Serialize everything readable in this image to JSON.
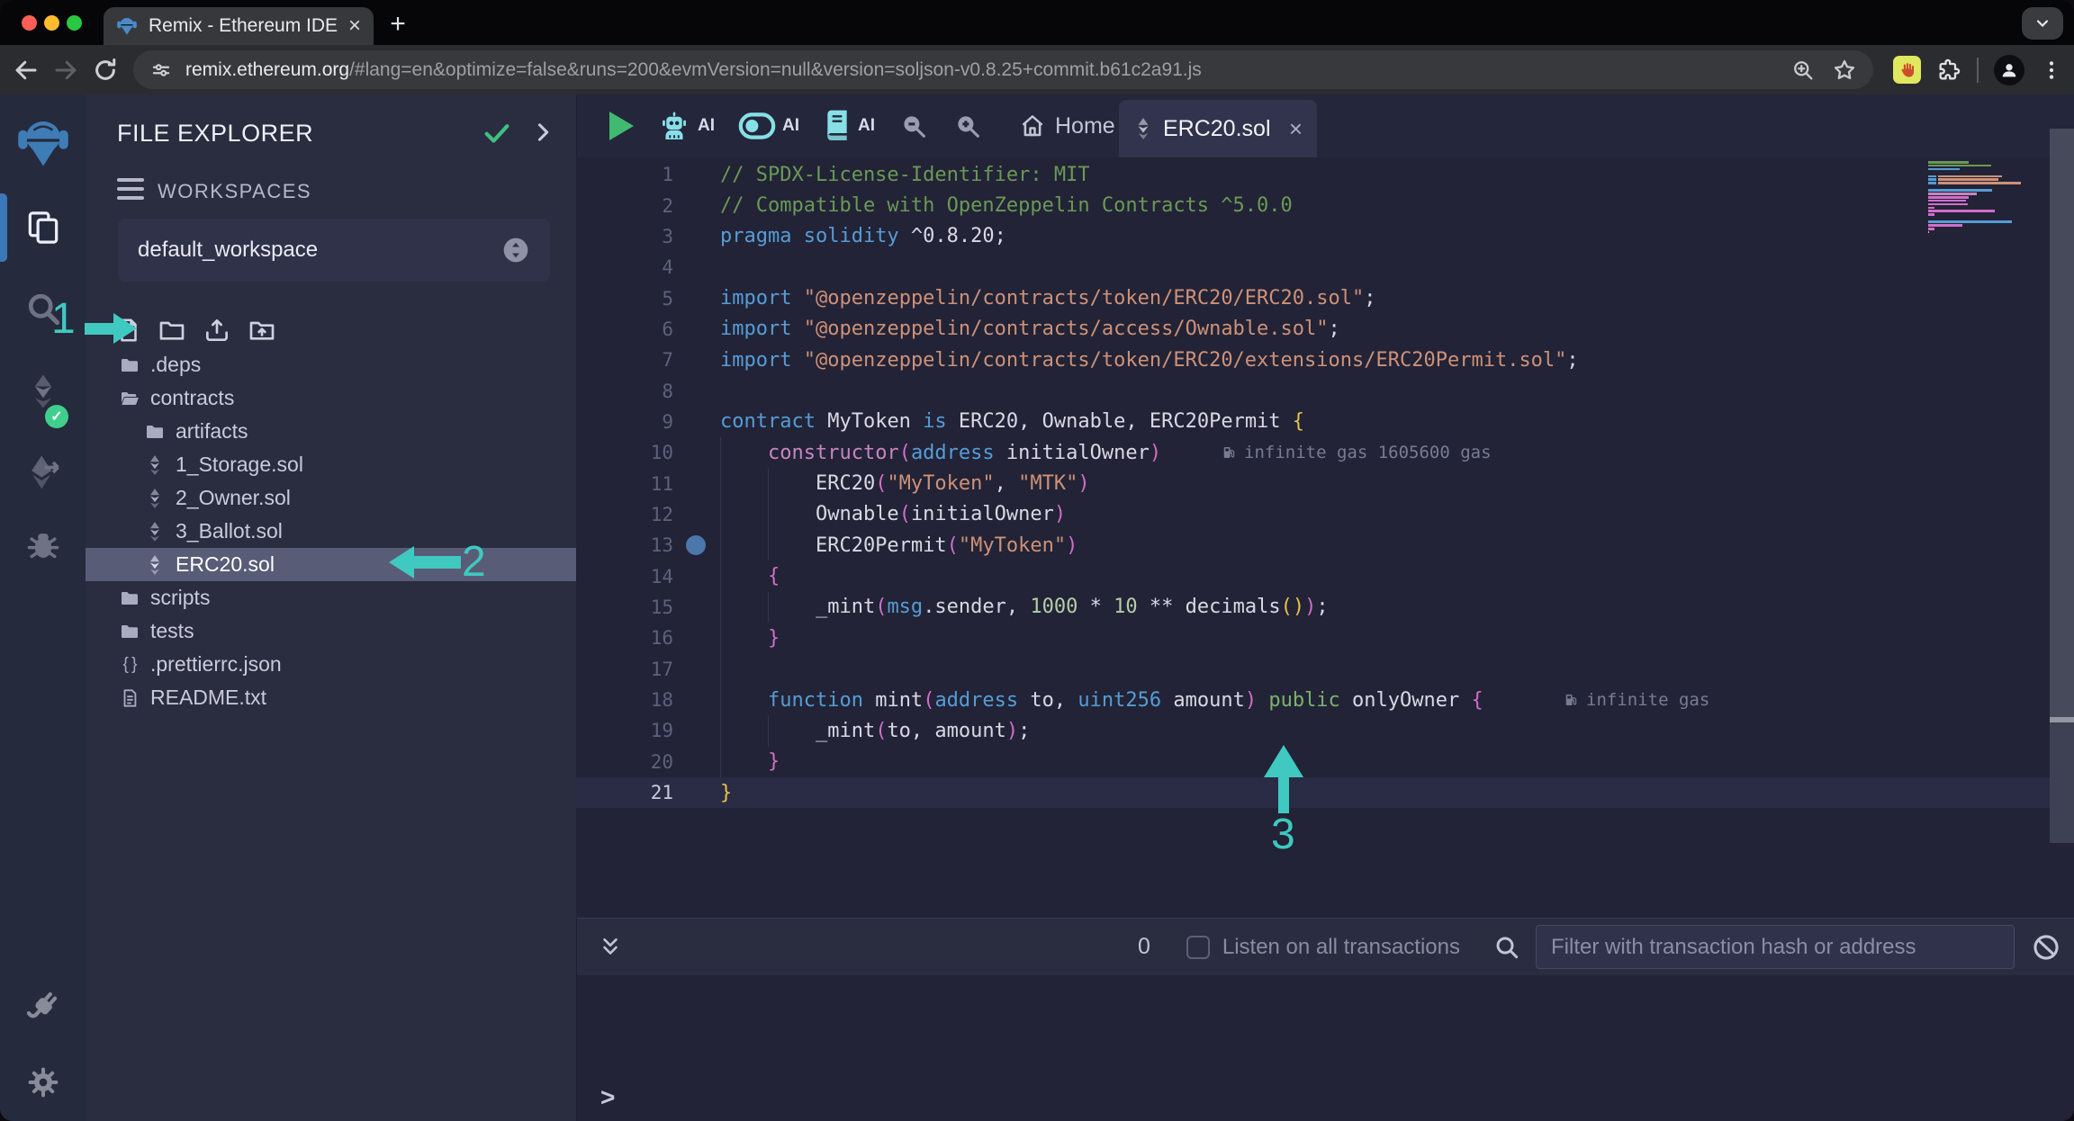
{
  "browser": {
    "tab_title": "Remix - Ethereum IDE",
    "new_tab": "+",
    "close_tab": "×",
    "url": {
      "domain": "remix.ethereum.org",
      "path": "/#lang=en&optimize=false&runs=200&evmVersion=null&version=soljson-v0.8.25+commit.b61c2a91.js"
    }
  },
  "activity_bar": {
    "icons": [
      "remix-logo",
      "file-explorer-icon",
      "search-icon",
      "solidity-compiler-icon",
      "deploy-run-icon",
      "debugger-icon",
      "plugin-manager-icon",
      "settings-icon"
    ],
    "compiler_badge": "check"
  },
  "file_explorer": {
    "title": "FILE EXPLORER",
    "workspaces_label": "WORKSPACES",
    "workspace_name": "default_workspace",
    "action_icons": [
      "new-file-icon",
      "new-folder-icon",
      "upload-file-icon",
      "upload-folder-icon"
    ],
    "tree": [
      {
        "label": ".deps",
        "icon": "folder",
        "indent": 0,
        "selected": false
      },
      {
        "label": "contracts",
        "icon": "folder-open",
        "indent": 0,
        "selected": false
      },
      {
        "label": "artifacts",
        "icon": "folder",
        "indent": 1,
        "selected": false
      },
      {
        "label": "1_Storage.sol",
        "icon": "solidity",
        "indent": 1,
        "selected": false
      },
      {
        "label": "2_Owner.sol",
        "icon": "solidity",
        "indent": 1,
        "selected": false
      },
      {
        "label": "3_Ballot.sol",
        "icon": "solidity",
        "indent": 1,
        "selected": false
      },
      {
        "label": "ERC20.sol",
        "icon": "solidity",
        "indent": 1,
        "selected": true
      },
      {
        "label": "scripts",
        "icon": "folder",
        "indent": 0,
        "selected": false
      },
      {
        "label": "tests",
        "icon": "folder",
        "indent": 0,
        "selected": false
      },
      {
        "label": ".prettierrc.json",
        "icon": "braces",
        "indent": 0,
        "selected": false
      },
      {
        "label": "README.txt",
        "icon": "file",
        "indent": 0,
        "selected": false
      }
    ]
  },
  "editor": {
    "ai_label": "AI",
    "home_label": "Home",
    "file_tab": "ERC20.sol",
    "close_tab": "×",
    "active_line": 21,
    "breakpoint_line": 13,
    "lines": [
      {
        "num": 1,
        "tokens": [
          [
            "c",
            "// SPDX-License-Identifier: MIT"
          ]
        ]
      },
      {
        "num": 2,
        "tokens": [
          [
            "c",
            "// Compatible with OpenZeppelin Contracts ^5.0.0"
          ]
        ]
      },
      {
        "num": 3,
        "tokens": [
          [
            "k",
            "pragma solidity"
          ],
          [
            "w",
            " ^0.8.20;"
          ]
        ]
      },
      {
        "num": 4,
        "tokens": []
      },
      {
        "num": 5,
        "tokens": [
          [
            "k",
            "import"
          ],
          [
            "w",
            " "
          ],
          [
            "s",
            "\"@openzeppelin/contracts/token/ERC20/ERC20.sol\""
          ],
          [
            "w",
            ";"
          ]
        ]
      },
      {
        "num": 6,
        "tokens": [
          [
            "k",
            "import"
          ],
          [
            "w",
            " "
          ],
          [
            "s",
            "\"@openzeppelin/contracts/access/Ownable.sol\""
          ],
          [
            "w",
            ";"
          ]
        ]
      },
      {
        "num": 7,
        "tokens": [
          [
            "k",
            "import"
          ],
          [
            "w",
            " "
          ],
          [
            "s",
            "\"@openzeppelin/contracts/token/ERC20/extensions/ERC20Permit.sol\""
          ],
          [
            "w",
            ";"
          ]
        ]
      },
      {
        "num": 8,
        "tokens": []
      },
      {
        "num": 9,
        "tokens": [
          [
            "k",
            "contract"
          ],
          [
            "w",
            " MyToken "
          ],
          [
            "k",
            "is"
          ],
          [
            "w",
            " ERC20, Ownable, ERC20Permit "
          ],
          [
            "p1",
            "{"
          ]
        ]
      },
      {
        "num": 10,
        "tokens": [
          [
            "w",
            "    "
          ],
          [
            "fn",
            "constructor"
          ],
          [
            "p2",
            "("
          ],
          [
            "k",
            "address"
          ],
          [
            "w",
            " initialOwner"
          ],
          [
            "p2",
            ")"
          ]
        ],
        "gas": "infinite gas 1605600 gas"
      },
      {
        "num": 11,
        "tokens": [
          [
            "w",
            "        ERC20"
          ],
          [
            "p2",
            "("
          ],
          [
            "s",
            "\"MyToken\""
          ],
          [
            "w",
            ", "
          ],
          [
            "s",
            "\"MTK\""
          ],
          [
            "p2",
            ")"
          ]
        ]
      },
      {
        "num": 12,
        "tokens": [
          [
            "w",
            "        Ownable"
          ],
          [
            "p2",
            "("
          ],
          [
            "w",
            "initialOwner"
          ],
          [
            "p2",
            ")"
          ]
        ]
      },
      {
        "num": 13,
        "tokens": [
          [
            "w",
            "        ERC20Permit"
          ],
          [
            "p2",
            "("
          ],
          [
            "s",
            "\"MyToken\""
          ],
          [
            "p2",
            ")"
          ]
        ]
      },
      {
        "num": 14,
        "tokens": [
          [
            "w",
            "    "
          ],
          [
            "p2",
            "{"
          ]
        ]
      },
      {
        "num": 15,
        "tokens": [
          [
            "w",
            "        _mint"
          ],
          [
            "p2",
            "("
          ],
          [
            "k",
            "msg"
          ],
          [
            "w",
            ".sender, "
          ],
          [
            "n",
            "1000"
          ],
          [
            "w",
            " * "
          ],
          [
            "n",
            "10"
          ],
          [
            "w",
            " ** decimals"
          ],
          [
            "p1",
            "()"
          ],
          [
            "p2",
            ")"
          ],
          [
            "w",
            ";"
          ]
        ]
      },
      {
        "num": 16,
        "tokens": [
          [
            "w",
            "    "
          ],
          [
            "p2",
            "}"
          ]
        ]
      },
      {
        "num": 17,
        "tokens": []
      },
      {
        "num": 18,
        "tokens": [
          [
            "w",
            "    "
          ],
          [
            "k",
            "function"
          ],
          [
            "w",
            " mint"
          ],
          [
            "p2",
            "("
          ],
          [
            "k",
            "address"
          ],
          [
            "w",
            " to, "
          ],
          [
            "k",
            "uint256"
          ],
          [
            "w",
            " amount"
          ],
          [
            "p2",
            ")"
          ],
          [
            "w",
            " "
          ],
          [
            "g",
            "public"
          ],
          [
            "w",
            " onlyOwner "
          ],
          [
            "p2",
            "{"
          ]
        ],
        "gas": "infinite gas"
      },
      {
        "num": 19,
        "tokens": [
          [
            "w",
            "        _mint"
          ],
          [
            "p2",
            "("
          ],
          [
            "w",
            "to, amount"
          ],
          [
            "p2",
            ")"
          ],
          [
            "w",
            ";"
          ]
        ]
      },
      {
        "num": 20,
        "tokens": [
          [
            "w",
            "    "
          ],
          [
            "p2",
            "}"
          ]
        ]
      },
      {
        "num": 21,
        "tokens": [
          [
            "p1",
            "}"
          ]
        ]
      }
    ]
  },
  "terminal": {
    "badge_count": "0",
    "listen_label": "Listen on all transactions",
    "filter_placeholder": "Filter with transaction hash or address",
    "prompt": ">"
  },
  "annotations": {
    "accent_color": "#3fc9c0",
    "step1": "1",
    "step2": "2",
    "step3": "3"
  }
}
